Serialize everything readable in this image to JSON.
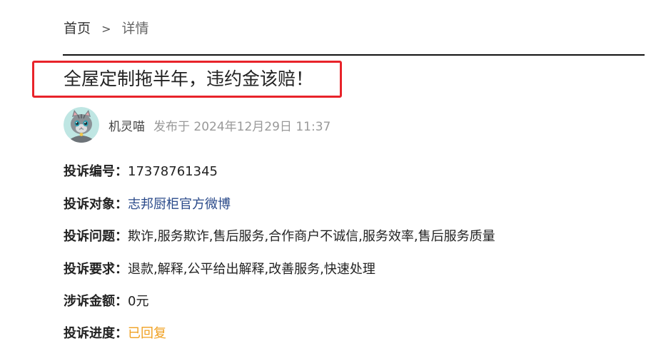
{
  "breadcrumb": {
    "home": "首页",
    "separator": ">",
    "current": "详情"
  },
  "title": "全屋定制拖半年，违约金该赔！",
  "author": {
    "name": "机灵喵",
    "published": "发布于 2024年12月29日 11:37"
  },
  "details": [
    {
      "label": "投诉编号：",
      "value": "17378761345"
    },
    {
      "label": "投诉对象：",
      "value": "志邦厨柜官方微博"
    },
    {
      "label": "投诉问题：",
      "value": "欺诈,服务欺诈,售后服务,合作商户不诚信,服务效率,售后服务质量"
    },
    {
      "label": "投诉要求：",
      "value": "退款,解释,公平给出解释,改善服务,快速处理"
    },
    {
      "label": "涉诉金额：",
      "value": "0元"
    },
    {
      "label": "投诉进度：",
      "value": "已回复"
    }
  ],
  "colors": {
    "highlight_border": "#e8232a",
    "link": "#2a4a8a",
    "status": "#f0a020",
    "muted": "#999999"
  },
  "icons": {
    "avatar": "gray-cat-avatar"
  }
}
